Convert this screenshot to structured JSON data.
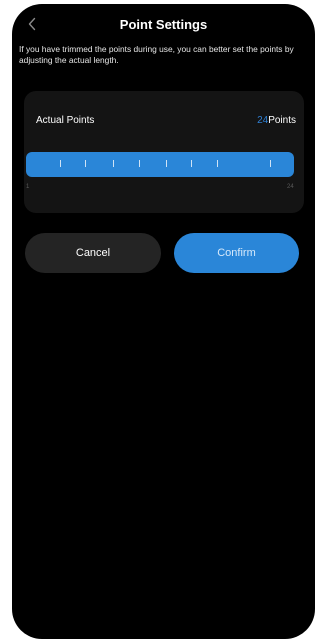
{
  "header": {
    "title": "Point Settings"
  },
  "description": "If you have trimmed the points during use, you can better set the points by adjusting the actual length.",
  "card": {
    "label": "Actual Points",
    "value": "24",
    "unit": "Points"
  },
  "slider": {
    "min": "1",
    "max": "24",
    "value": 24
  },
  "buttons": {
    "cancel": "Cancel",
    "confirm": "Confirm"
  },
  "colors": {
    "accent": "#2a86d8",
    "background": "#000000",
    "card": "#141414",
    "cancel_button": "#242424"
  },
  "icons": {
    "back": "chevron-left-icon"
  }
}
